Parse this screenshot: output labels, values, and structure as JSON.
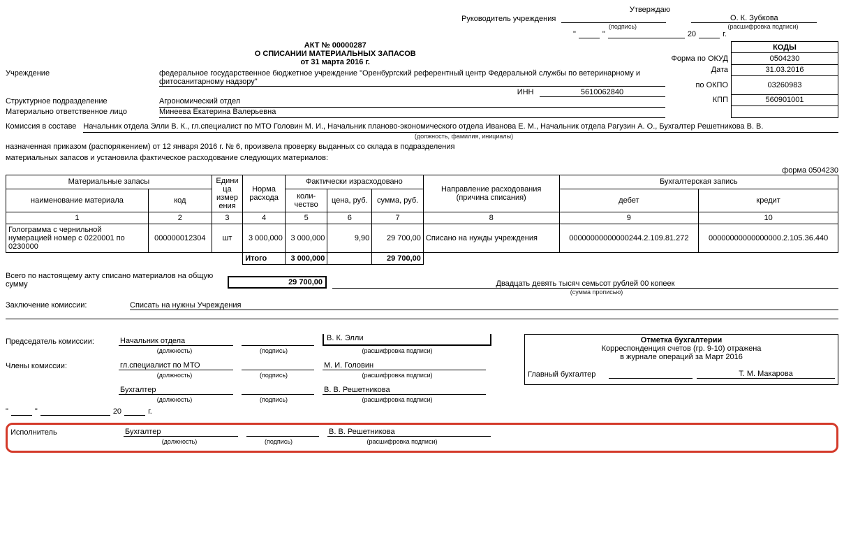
{
  "approve": {
    "title": "Утверждаю",
    "leader_label": "Руководитель учреждения",
    "signature_caption": "(подпись)",
    "name": "О. К. Зубкова",
    "name_caption": "(расшифровка подписи)",
    "date_year_prefix": "20",
    "date_year_suffix": "г."
  },
  "title": {
    "act": "АКТ № 00000287",
    "about": "О СПИСАНИИ МАТЕРИАЛЬНЫХ ЗАПАСОВ",
    "date": "от 31 марта 2016 г."
  },
  "codes": {
    "header": "КОДЫ",
    "okud_label": "Форма  по ОКУД",
    "okud": "0504230",
    "date_label": "Дата",
    "date": "31.03.2016",
    "okpo_label": "по ОКПО",
    "okpo": "03260983",
    "kpp_label": "КПП",
    "kpp": "560901001"
  },
  "header_fields": {
    "institution_label": "Учреждение",
    "institution": "федеральное государственное бюджетное учреждение \"Оренбургский референтный центр Федеральной службы по ветеринарному и фитосанитарному надзору\"",
    "inn_label": "ИНН",
    "inn": "5610062840",
    "department_label": "Структурное подразделение",
    "department": "Агрономический отдел",
    "responsible_label": "Материально ответственное лицо",
    "responsible": "Минеева Екатерина Валерьевна"
  },
  "commission": {
    "label": "Комиссия в составе",
    "members": "Начальник отдела Элли В. К., гл.специалист по МТО Головин М. И., Начальник планово-экономического отдела Иванова Е. М., Начальник отдела Рагузин А. О., Бухгалтер Решетникова В. В.",
    "caption": "(должность, фамилия, инициалы)",
    "line1": "назначенная приказом (распоряжением)  от  12 января 2016 г.  № 6, произвела проверку выданных со склада в подразделения",
    "line2": "материальных запасов и установила фактическое расходование следующих материалов:"
  },
  "form_code_right": "форма 0504230",
  "table": {
    "headers": {
      "materials": "Материальные запасы",
      "name": "наименование материала",
      "code": "код",
      "unit": "Едини ца измер ения",
      "norm": "Норма расхода",
      "spent": "Фактически израсходовано",
      "qty": "коли- чество",
      "price": "цена, руб.",
      "sum": "сумма, руб.",
      "direction": "Направление расходования (причина списания)",
      "accounting": "Бухгалтерская запись",
      "debit": "дебет",
      "credit": "кредит"
    },
    "colnums": [
      "1",
      "2",
      "3",
      "4",
      "5",
      "6",
      "7",
      "8",
      "9",
      "10"
    ],
    "rows": [
      {
        "name": "Голограмма с чернильной нумерацией номер с 0220001 по 0230000",
        "code": "000000012304",
        "unit": "шт",
        "norm": "3 000,000",
        "qty": "3 000,000",
        "price": "9,90",
        "sum": "29 700,00",
        "direction": "Списано на нужды учреждения",
        "debit": "00000000000000244.2.109.81.272",
        "credit": "00000000000000000.2.105.36.440"
      }
    ],
    "total_label": "Итого",
    "total_qty": "3 000,000",
    "total_sum": "29 700,00"
  },
  "totals": {
    "label": "Всего по настоящему акту списано материалов на общую сумму",
    "amount": "29 700,00",
    "words": "Двадцать девять тысяч семьсот рублей 00 копеек",
    "words_caption": "(сумма прописью)"
  },
  "conclusion": {
    "label": "Заключение комиссии:",
    "text": "Списать на нужны Учреждения"
  },
  "signatures": {
    "chairman_label": "Председатель комиссии:",
    "chairman_position": "Начальник отдела",
    "chairman_name": "В. К. Элли",
    "members_label": "Члены комиссии:",
    "member1_position": "гл.специалист по МТО",
    "member1_name": "М. И. Головин",
    "member2_position": "Бухгалтер",
    "member2_name": "В. В. Решетникова",
    "position_caption": "(должность)",
    "signature_caption": "(подпись)",
    "name_caption": "(расшифровка подписи)",
    "date_year_prefix": "20",
    "date_year_suffix": "г."
  },
  "accounting_note": {
    "title": "Отметка бухгалтерии",
    "line1": "Корреспонденция счетов (гр. 9-10) отражена",
    "line2": "в журнале операций за Март 2016",
    "chief_label": "Главный бухгалтер",
    "chief_name": "Т. М. Макарова"
  },
  "executor": {
    "label": "Исполнитель",
    "position": "Бухгалтер",
    "name": "В. В. Решетникова",
    "position_caption": "(должность)",
    "signature_caption": "(подпись)",
    "name_caption": "(расшифровка подписи)"
  }
}
